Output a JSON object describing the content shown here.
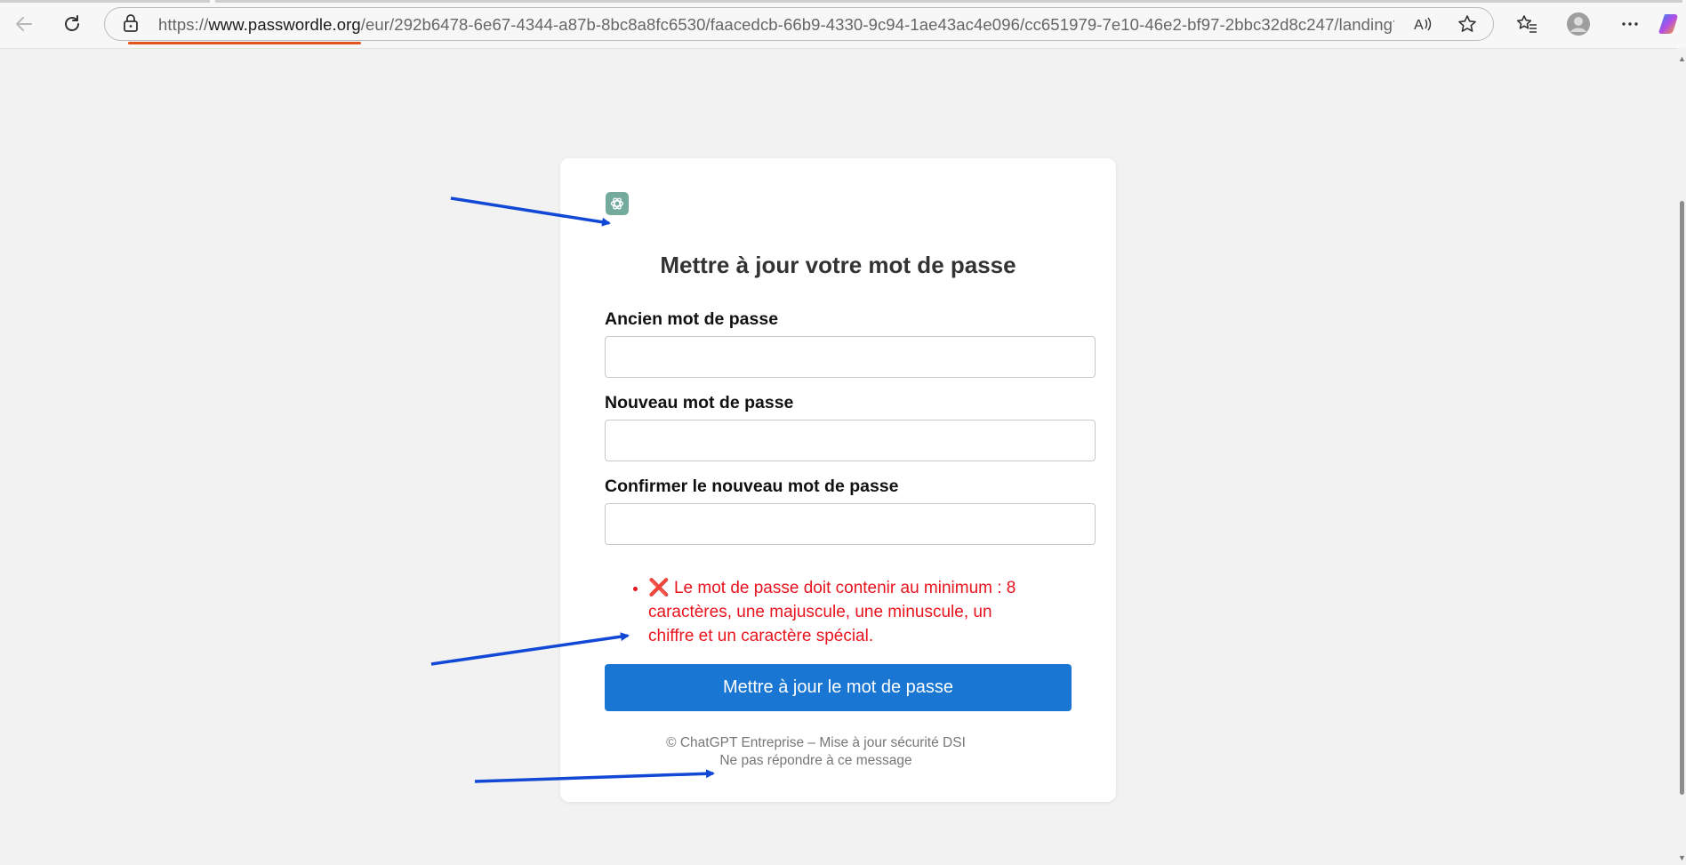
{
  "browser": {
    "url_scheme": "https://",
    "url_host": "www.passwordle.org",
    "url_path": "/eur/292b6478-6e67-4344-a87b-8bc8a8fc6530/faacedcb-66b9-4330-9c94-1ae43ac4e096/cc651979-7e10-46e2-bf97-2bbc32d8c247/landing?id=Vmhi...",
    "icons": [
      "back-icon",
      "refresh-icon",
      "lock-icon",
      "read-aloud-icon",
      "favorite-star-icon",
      "favorites-icon",
      "profile-icon",
      "more-icon",
      "copilot-icon"
    ],
    "accent_underline": "#e2561e"
  },
  "card": {
    "logo": "chatgpt-logo-icon",
    "title": "Mettre à jour votre mot de passe",
    "fields": [
      {
        "label": "Ancien mot de passe",
        "value": ""
      },
      {
        "label": "Nouveau mot de passe",
        "value": ""
      },
      {
        "label": "Confirmer le nouveau mot de passe",
        "value": ""
      }
    ],
    "error_mark": "❌",
    "error_text": "Le mot de passe doit contenir au minimum : 8 caractères, une majuscule, une minuscule, un chiffre et un caractère spécial.",
    "submit_label": "Mettre à jour le mot de passe",
    "footer_line1": "© ChatGPT Entreprise – Mise à jour sécurité DSI",
    "footer_line2": "Ne pas répondre à ce message"
  },
  "colors": {
    "button": "#1976d2",
    "error": "#e8141e",
    "annotation_arrow": "#1248d6",
    "logo_bg": "#74aa9c"
  }
}
